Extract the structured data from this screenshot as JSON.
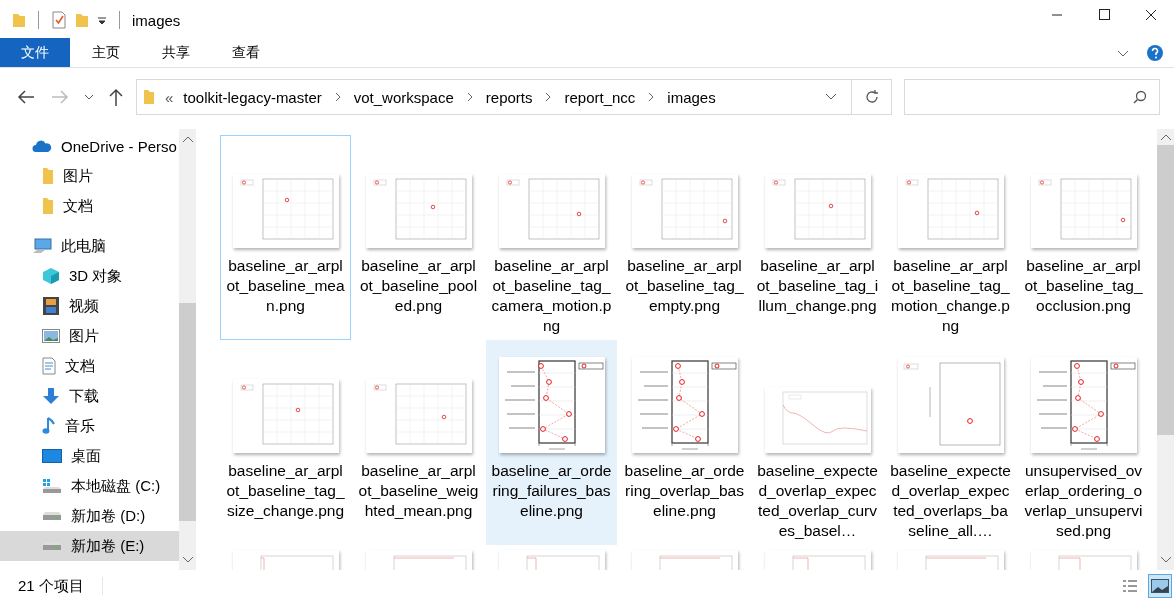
{
  "window": {
    "title": "images"
  },
  "ribbon": {
    "tabs": [
      {
        "label": "文件",
        "selected": true
      },
      {
        "label": "主页",
        "selected": false
      },
      {
        "label": "共享",
        "selected": false
      },
      {
        "label": "查看",
        "selected": false
      }
    ]
  },
  "address": {
    "overflow": "«",
    "crumbs": [
      "toolkit-legacy-master",
      "vot_workspace",
      "reports",
      "report_ncc",
      "images"
    ]
  },
  "sidebar": {
    "items": [
      {
        "label": "OneDrive - Perso",
        "kind": "cloud",
        "selected": false
      },
      {
        "label": "图片",
        "kind": "folder",
        "selected": false
      },
      {
        "label": "文档",
        "kind": "folder",
        "selected": false
      },
      {
        "label": "此电脑",
        "kind": "pc",
        "selected": false
      },
      {
        "label": "3D 对象",
        "kind": "cube",
        "selected": false
      },
      {
        "label": "视频",
        "kind": "film",
        "selected": false
      },
      {
        "label": "图片",
        "selected": false
      },
      {
        "label": "文档",
        "kind": "doc",
        "selected": false
      },
      {
        "label": "下载",
        "kind": "download",
        "selected": false
      },
      {
        "label": "音乐",
        "kind": "music",
        "selected": false
      },
      {
        "label": "桌面",
        "kind": "desktop",
        "selected": false
      },
      {
        "label": "本地磁盘 (C:)",
        "kind": "sysdrive",
        "selected": false
      },
      {
        "label": "新加卷 (D:)",
        "kind": "drive",
        "selected": false
      },
      {
        "label": "新加卷 (E:)",
        "kind": "drive",
        "selected": true
      }
    ]
  },
  "files": [
    {
      "name": "baseline_ar_arplot_baseline_mean.png",
      "kind": "arplot",
      "focused": true,
      "selected": false
    },
    {
      "name": "baseline_ar_arplot_baseline_pooled.png",
      "kind": "arplot",
      "focused": false,
      "selected": false
    },
    {
      "name": "baseline_ar_arplot_baseline_tag_camera_motion.png",
      "kind": "arplot",
      "focused": false,
      "selected": false
    },
    {
      "name": "baseline_ar_arplot_baseline_tag_empty.png",
      "kind": "arplot",
      "focused": false,
      "selected": false
    },
    {
      "name": "baseline_ar_arplot_baseline_tag_illum_change.png",
      "kind": "arplot",
      "focused": false,
      "selected": false
    },
    {
      "name": "baseline_ar_arplot_baseline_tag_motion_change.png",
      "kind": "arplot",
      "focused": false,
      "selected": false
    },
    {
      "name": "baseline_ar_arplot_baseline_tag_occlusion.png",
      "kind": "arplot",
      "focused": false,
      "selected": false
    },
    {
      "name": "baseline_ar_arplot_baseline_tag_size_change.png",
      "kind": "arplot",
      "focused": false,
      "selected": false
    },
    {
      "name": "baseline_ar_arplot_baseline_weighted_mean.png",
      "kind": "arplot",
      "focused": false,
      "selected": false
    },
    {
      "name": "baseline_ar_ordering_failures_baseline.png",
      "kind": "ordering",
      "focused": false,
      "selected": true
    },
    {
      "name": "baseline_ar_ordering_overlap_baseline.png",
      "kind": "ordering",
      "focused": false,
      "selected": false
    },
    {
      "name": "baseline_expected_overlap_expected_overlap_curves_basel…",
      "kind": "curve",
      "focused": false,
      "selected": false
    },
    {
      "name": "baseline_expected_overlap_expected_overlaps_baseline_all.…",
      "kind": "single",
      "focused": false,
      "selected": false
    },
    {
      "name": "unsupervised_overlap_ordering_overlap_unsupervised.png",
      "kind": "ordering",
      "focused": false,
      "selected": false
    }
  ],
  "status_bar": {
    "count": "21 个项目",
    "views": [
      {
        "kind": "details",
        "selected": false
      },
      {
        "kind": "icons",
        "selected": true
      }
    ]
  }
}
